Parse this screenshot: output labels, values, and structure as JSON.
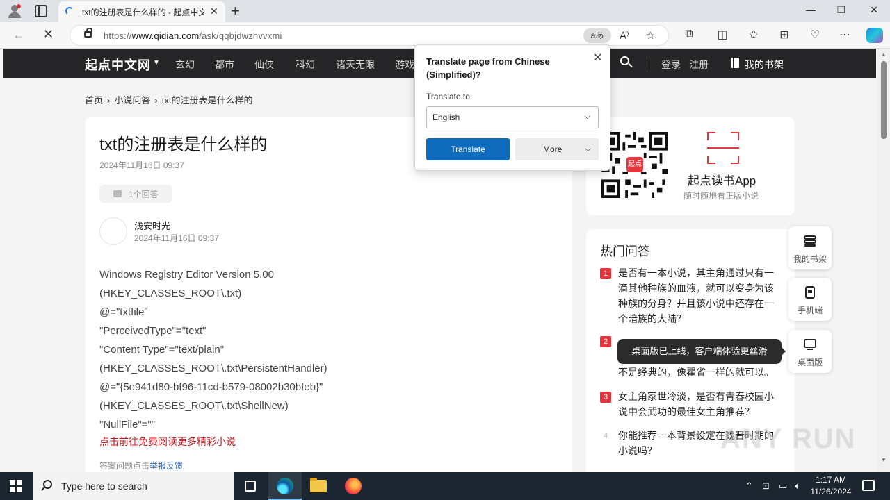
{
  "browser": {
    "tab_title": "txt的注册表是什么样的 - 起点中文网",
    "url_prefix": "https://",
    "url_host": "www.qidian.com",
    "url_path": "/ask/qqbjdwzhvvxmi",
    "translate_pill": "ḁあ",
    "translate_pill_text": "aあ"
  },
  "translate_popup": {
    "title": "Translate page from Chinese (Simplified)?",
    "label": "Translate to",
    "language": "English",
    "translate_button": "Translate",
    "more_button": "More"
  },
  "site_nav": {
    "logo": "起点中文网",
    "items": [
      "玄幻",
      "都市",
      "仙侠",
      "科幻",
      "诸天无限",
      "游戏"
    ],
    "login": "登录",
    "register": "注册",
    "bookshelf": "我的书架"
  },
  "breadcrumb": [
    "首页",
    "小说问答",
    "txt的注册表是什么样的"
  ],
  "question": {
    "title": "txt的注册表是什么样的",
    "date": "2024年11月16日 09:37",
    "answer_count": "1个回答"
  },
  "answer": {
    "author": "浅安时光",
    "date": "2024年11月16日 09:37",
    "lines": [
      "Windows Registry Editor Version 5.00",
      "(HKEY_CLASSES_ROOT\\.txt)",
      "@=\"txtfile\"",
      "\"PerceivedType\"=\"text\"",
      "\"Content Type\"=\"text/plain\"",
      "(HKEY_CLASSES_ROOT\\.txt\\PersistentHandler)",
      "@=\"{5e941d80-bf96-11cd-b579-08002b30bfeb}\"",
      "(HKEY_CLASSES_ROOT\\.txt\\ShellNew)",
      "\"NullFile\"=\"\""
    ],
    "cta": "点击前往免费阅读更多精彩小说",
    "report_prefix": "答案问题点击",
    "report_link": "举报反馈"
  },
  "app_card": {
    "qr_badge": "起点",
    "name": "起点读书App",
    "subtitle": "随时随地看正版小说"
  },
  "hot": {
    "title": "热门问答",
    "items": [
      {
        "rank": "1",
        "text": "是否有一本小说，其主角通过只有一滴其他种族的血液，就可以变身为该种族的分身？并且该小说中还存在一个暗族的大陆？"
      },
      {
        "rank": "2",
        "text": "不是经典的，像瞿省一样的就可以。"
      },
      {
        "rank": "3",
        "text": "女主角家世冷淡，是否有青春校园小说中会武功的最佳女主角推荐？"
      },
      {
        "rank": "4",
        "text": "你能推荐一本背景设定在魏晋时期的小说吗？"
      }
    ]
  },
  "side_tools": {
    "bookshelf": "我的书架",
    "mobile": "手机端",
    "desktop": "桌面版",
    "tooltip": "桌面版已上线，客户端体验更丝滑"
  },
  "watermark": "ANY RUN",
  "taskbar": {
    "search_placeholder": "Type here to search",
    "time": "1:17 AM",
    "date": "11/26/2024"
  }
}
